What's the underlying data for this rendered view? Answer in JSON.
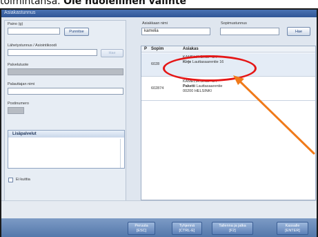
{
  "caption": {
    "prefix": "toimintansa. ",
    "bold": "Ole huolellinen valinte"
  },
  "window": {
    "title": "Asiakastunnus"
  },
  "left": {
    "weight_label": "Paino (g)",
    "weight_value": "",
    "weigh_button": "Punnitse",
    "tracking_label": "Lähetystunnus / Asiointikoodi",
    "tracking_value": "",
    "tracking_button": "Hae",
    "service_label": "Palvelutuote",
    "recipient_label": "Palauttajan nimi",
    "recipient_value": "",
    "postcode_label": "Postinumero",
    "extra_services_header": "Lisäpalvelut",
    "no_label_check": "Ei kuittia"
  },
  "search": {
    "customer_label": "Asiakkaan nimi",
    "customer_value": "kamelia",
    "contract_label": "Sopimustunnus",
    "contract_value": "",
    "search_button": "Hae"
  },
  "results": {
    "headers": [
      "P",
      "Sopim",
      "Asiakas"
    ],
    "rows": [
      {
        "contract": "6028",
        "name": "KAMELIA SHOP OY",
        "type": "Kirje",
        "address": "Lauttasaarentie 16",
        "city": ""
      },
      {
        "contract": "602874",
        "name": "KAMELIA SHOP OY",
        "type": "Paketti",
        "address": "Lauttasaarentie",
        "city": "00200 HELSINKI"
      }
    ]
  },
  "footer": {
    "buttons": [
      {
        "label": "Peruuta",
        "key": "[ESC]"
      },
      {
        "label": "Tyhjennä",
        "key": "[CTRL-E]"
      },
      {
        "label": "Tallenna ja jatka",
        "key": "[F2]"
      },
      {
        "label": "Kassalle",
        "key": "[ENTER]"
      }
    ]
  },
  "colors": {
    "highlight": "#e51616",
    "arrow": "#f07a1a",
    "accent": "#2f5596"
  }
}
